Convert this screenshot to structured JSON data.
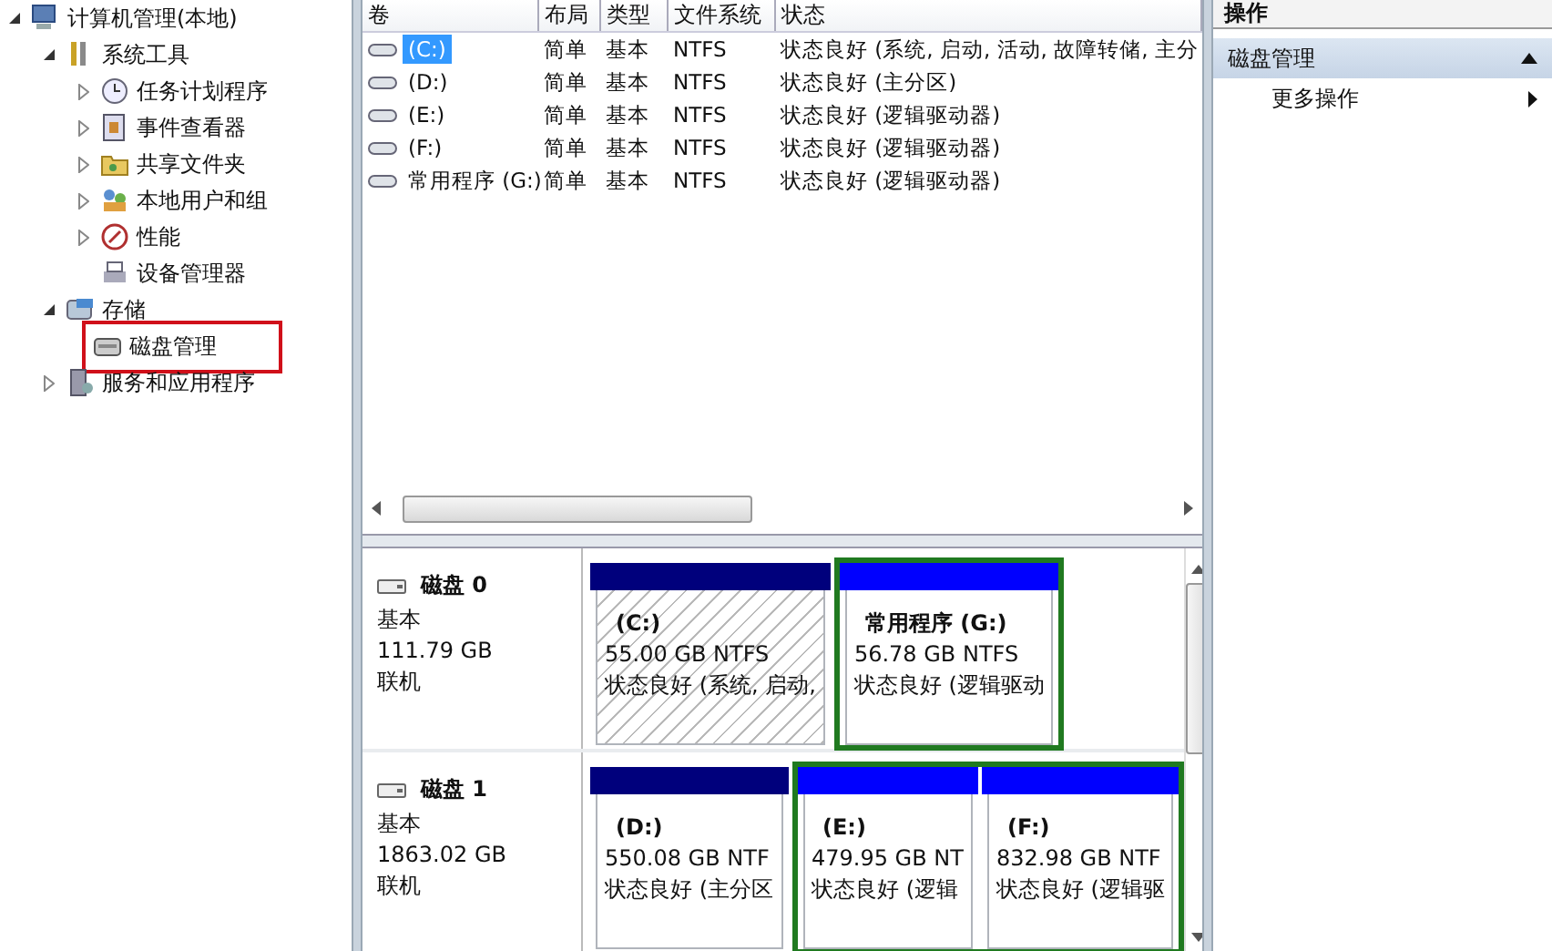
{
  "tree": [
    {
      "label": "计算机管理(本地)",
      "expanded": true,
      "children": [
        {
          "label": "系统工具",
          "expanded": true,
          "children": [
            {
              "label": "任务计划程序",
              "expanded": false
            },
            {
              "label": "事件查看器",
              "expanded": false
            },
            {
              "label": "共享文件夹",
              "expanded": false
            },
            {
              "label": "本地用户和组",
              "expanded": false
            },
            {
              "label": "性能",
              "expanded": false
            },
            {
              "label": "设备管理器"
            }
          ]
        },
        {
          "label": "存储",
          "expanded": true,
          "children": [
            {
              "label": "磁盘管理",
              "annotated": true
            }
          ]
        },
        {
          "label": "服务和应用程序",
          "expanded": false
        }
      ]
    }
  ],
  "volumes": {
    "columns": [
      "卷",
      "布局",
      "类型",
      "文件系统",
      "状态"
    ],
    "rows": [
      {
        "cells": [
          "(C:)",
          "简单",
          "基本",
          "NTFS",
          "状态良好 (系统, 启动, 活动, 故障转储, 主分"
        ],
        "selected": true
      },
      {
        "cells": [
          "(D:)",
          "简单",
          "基本",
          "NTFS",
          "状态良好 (主分区)"
        ],
        "selected": false
      },
      {
        "cells": [
          "(E:)",
          "简单",
          "基本",
          "NTFS",
          "状态良好 (逻辑驱动器)"
        ],
        "selected": false
      },
      {
        "cells": [
          "(F:)",
          "简单",
          "基本",
          "NTFS",
          "状态良好 (逻辑驱动器)"
        ],
        "selected": false
      },
      {
        "cells": [
          "常用程序 (G:)",
          "简单",
          "基本",
          "NTFS",
          "状态良好 (逻辑驱动器)"
        ],
        "selected": false
      }
    ]
  },
  "disks": [
    {
      "name": "磁盘 0",
      "type": "基本",
      "size": "111.79 GB",
      "status": "联机",
      "partitions": [
        {
          "kind": "primary",
          "selected": true,
          "name": "(C:)",
          "size": "55.00 GB NTFS",
          "status": "状态良好 (系统, 启动,"
        },
        {
          "kind": "extended",
          "children": [
            {
              "kind": "logical",
              "selected": false,
              "name": "常用程序  (G:)",
              "size": "56.78 GB NTFS",
              "status": "状态良好 (逻辑驱动"
            }
          ]
        }
      ]
    },
    {
      "name": "磁盘 1",
      "type": "基本",
      "size": "1863.02 GB",
      "status": "联机",
      "partitions": [
        {
          "kind": "primary",
          "selected": false,
          "name": "(D:)",
          "size": "550.08 GB NTF",
          "status": "状态良好 (主分区"
        },
        {
          "kind": "extended",
          "children": [
            {
              "kind": "logical",
              "selected": false,
              "name": "(E:)",
              "size": "479.95 GB NT",
              "status": "状态良好 (逻辑"
            },
            {
              "kind": "logical",
              "selected": false,
              "name": "(F:)",
              "size": "832.98 GB NTF",
              "status": "状态良好 (逻辑驱"
            }
          ]
        }
      ]
    }
  ],
  "actions": {
    "title": "操作",
    "items": [
      {
        "label": "磁盘管理",
        "kind": "section",
        "expanded": true
      },
      {
        "label": "更多操作",
        "kind": "submenu"
      }
    ]
  }
}
